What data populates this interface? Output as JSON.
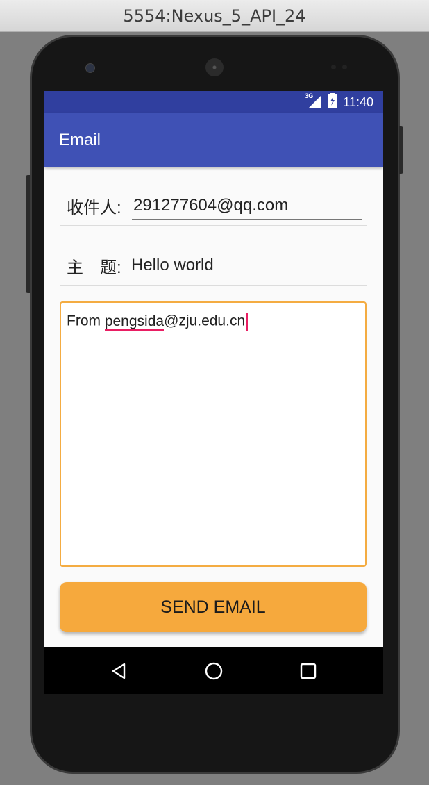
{
  "window": {
    "title": "5554:Nexus_5_API_24"
  },
  "status_bar": {
    "network": "3G",
    "time": "11:40"
  },
  "app_bar": {
    "title": "Email"
  },
  "form": {
    "recipient_label": "收件人:",
    "recipient_value": "291277604@qq.com",
    "subject_label": "主　题:",
    "subject_value": "Hello world",
    "body_prefix": "From ",
    "body_misspelled": "pengsida",
    "body_suffix": "@zju.edu.cn"
  },
  "send_button": {
    "label": "SEND EMAIL"
  },
  "nav_bar": {
    "back": "back-icon",
    "home": "home-icon",
    "recents": "recents-icon"
  },
  "colors": {
    "status_bar": "#303f9f",
    "app_bar": "#3f51b5",
    "accent": "#f6a93d",
    "caret": "#e91e63"
  }
}
